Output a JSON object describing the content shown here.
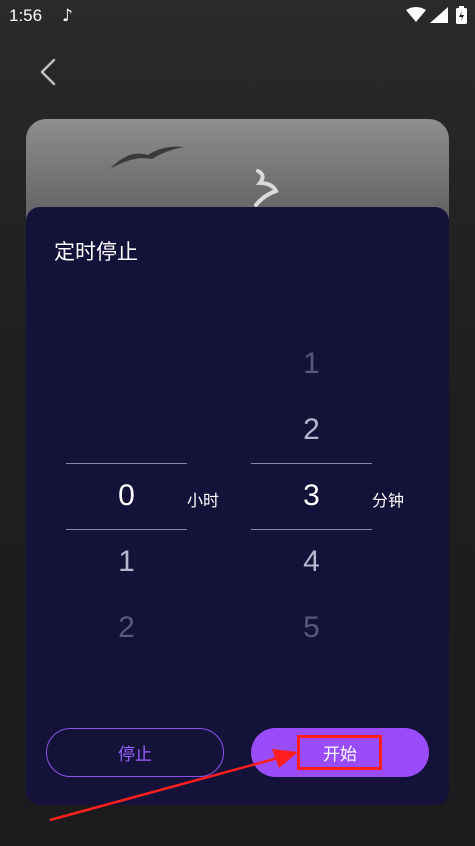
{
  "status_bar": {
    "time": "1:56"
  },
  "sheet": {
    "title": "定时停止",
    "hours": {
      "values": [
        "0",
        "1",
        "2"
      ],
      "selected": "0",
      "unit": "小时"
    },
    "minutes": {
      "values": [
        "1",
        "2",
        "3",
        "4",
        "5"
      ],
      "selected": "3",
      "unit": "分钟"
    },
    "stop_label": "停止",
    "start_label": "开始"
  },
  "colors": {
    "sheet_bg": "#15123a",
    "accent": "#9a4cfa",
    "annotation": "#ff1e1e"
  }
}
